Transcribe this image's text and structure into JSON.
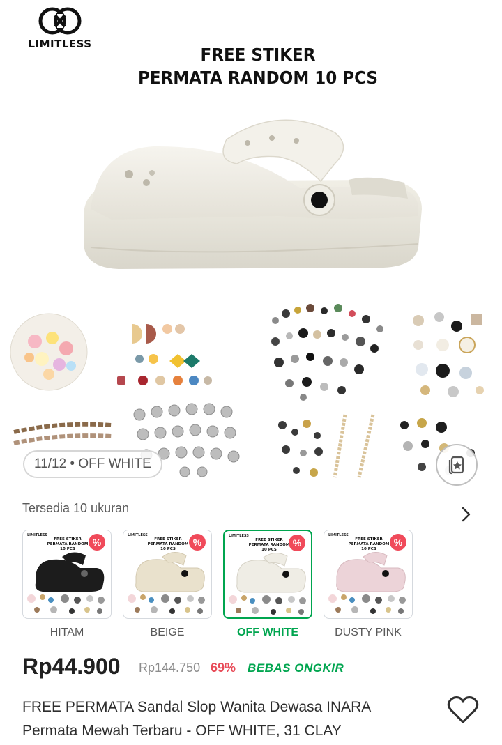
{
  "gallery": {
    "brand_name": "LIMITLESS",
    "promo_line1": "FREE STIKER",
    "promo_line2": "PERMATA RANDOM 10 PCS",
    "counter": "11/12 • OFF WHITE",
    "catalog_icon": "catalog-icon"
  },
  "variants": {
    "available_text": "Tersedia 10 ukuran",
    "items": [
      {
        "label": "HITAM",
        "shoe_color": "#1c1c1c",
        "badge": "%",
        "selected": false
      },
      {
        "label": "BEIGE",
        "shoe_color": "#e9e1cc",
        "badge": "%",
        "selected": false
      },
      {
        "label": "OFF WHITE",
        "shoe_color": "#efede5",
        "badge": "%",
        "selected": true
      },
      {
        "label": "DUSTY PINK",
        "shoe_color": "#ecd3d8",
        "badge": "%",
        "selected": false
      }
    ],
    "thumb_brand": "LIMITLESS",
    "thumb_promo_line1": "FREE STIKER",
    "thumb_promo_line2": "PERMATA RANDOM 10 PCS"
  },
  "product": {
    "price": "Rp44.900",
    "original_price": "Rp144.750",
    "discount": "69%",
    "shipping": "BEBAS ONGKIR",
    "title": "FREE PERMATA Sandal Slop Wanita Dewasa INARA Permata Mewah Terbaru - OFF WHITE, 31 CLAY"
  },
  "colors": {
    "accent_green": "#00a54f",
    "discount_red": "#e84c59",
    "badge_red": "#f04a5a",
    "text_primary": "#212121",
    "text_secondary": "#5a5a5a"
  }
}
